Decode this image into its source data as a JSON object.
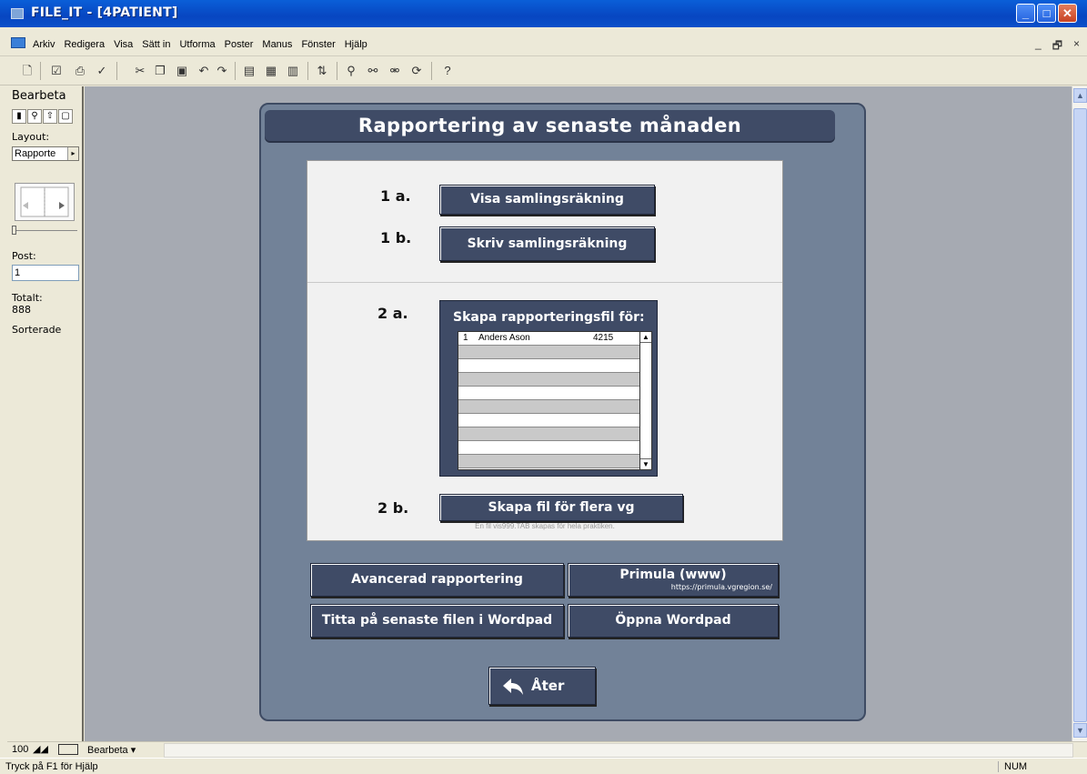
{
  "window": {
    "title": "FILE_IT - [4PATIENT]",
    "minimize": "_",
    "maximize": "□",
    "close": "✕"
  },
  "menu": {
    "items": [
      "Arkiv",
      "Redigera",
      "Visa",
      "Sätt in",
      "Utforma",
      "Poster",
      "Manus",
      "Fönster",
      "Hjälp"
    ],
    "mdi": [
      "_",
      "🗗",
      "×"
    ]
  },
  "sidebar": {
    "mode": "Bearbeta",
    "layout_label": "Layout:",
    "layout_value": "Rapporte",
    "post_label": "Post:",
    "post_value": "1",
    "total_label": "Totalt:",
    "total_value": "888",
    "sorted_label": "Sorterade"
  },
  "bottombar": {
    "zoom": "100",
    "mode": "Bearbeta"
  },
  "statusbar": {
    "help": "Tryck på F1 för Hjälp",
    "num": "NUM"
  },
  "form": {
    "title": "Rapportering av senaste månaden",
    "step_1a": "1 a.",
    "btn_1a": "Visa samlingsräkning",
    "step_1b": "1 b.",
    "btn_1b": "Skriv samlingsräkning",
    "step_2a": "2 a.",
    "list_title": "Skapa rapporteringsfil för:",
    "list_rows": [
      {
        "num": "1",
        "name": "Anders Ason",
        "code": "4215"
      },
      {
        "num": "",
        "name": "",
        "code": ""
      },
      {
        "num": "",
        "name": "",
        "code": ""
      },
      {
        "num": "",
        "name": "",
        "code": ""
      },
      {
        "num": "",
        "name": "",
        "code": ""
      },
      {
        "num": "",
        "name": "",
        "code": ""
      },
      {
        "num": "",
        "name": "",
        "code": ""
      },
      {
        "num": "",
        "name": "",
        "code": ""
      },
      {
        "num": "",
        "name": "",
        "code": ""
      },
      {
        "num": "",
        "name": "",
        "code": ""
      }
    ],
    "step_2b": "2 b.",
    "btn_2b": "Skapa fil för flera vg",
    "note_2b": "En fil vis999.TAB skapas för hela praktiken.",
    "btn_advanced": "Avancerad rapportering",
    "btn_primula": "Primula (www)",
    "primula_url": "https://primula.vgregion.se/",
    "btn_view_last": "Titta på senaste filen i  Wordpad",
    "btn_open_wordpad": "Öppna Wordpad",
    "btn_back": "Åter"
  }
}
